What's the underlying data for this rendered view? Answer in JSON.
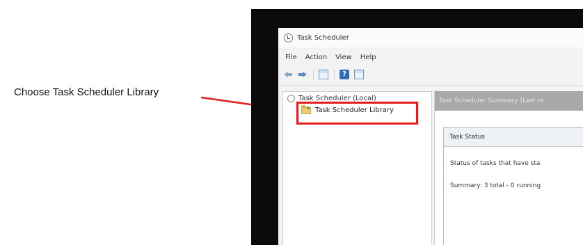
{
  "callout": {
    "text": "Choose Task Scheduler Library",
    "color": "#e21f1f"
  },
  "window": {
    "title": "Task Scheduler",
    "menu": [
      "File",
      "Action",
      "View",
      "Help"
    ],
    "toolbar_icons": [
      "back-arrow-icon",
      "forward-arrow-icon",
      "console-tree-icon",
      "help-icon",
      "action-pane-icon"
    ]
  },
  "tree": {
    "root_label": "Task Scheduler (Local)",
    "library_label": "Task Scheduler Library"
  },
  "summary": {
    "header": "Task Scheduler Summary (Last re",
    "card_title": "Task Status",
    "status_text": "Status of tasks that have sta",
    "summary_text": "Summary: 3 total - 0 running"
  }
}
